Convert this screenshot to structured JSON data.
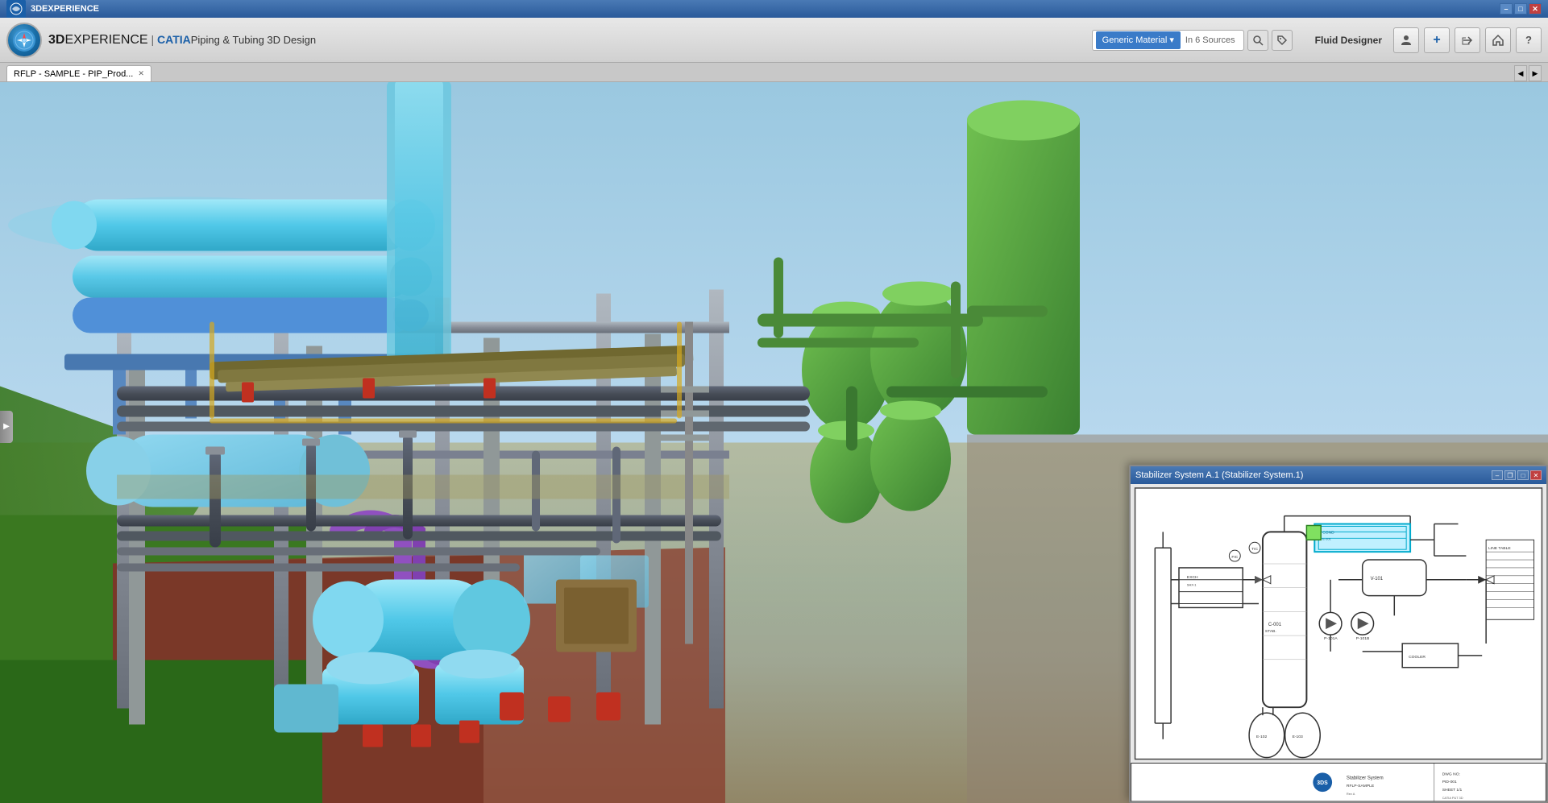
{
  "titlebar": {
    "title": "3DEXPERIENCE",
    "min_label": "–",
    "max_label": "□",
    "close_label": "✕"
  },
  "toolbar": {
    "app_name_prefix": "3D",
    "app_name_suffix": "EXPERIENCE",
    "separator": " | ",
    "catia_label": "CATIA",
    "app_subtitle": "Piping & Tubing 3D Design",
    "fluid_designer_label": "Fluid Designer"
  },
  "search": {
    "material_label": "Generic Material",
    "dropdown_arrow": "▾",
    "sources_text": "In 6 Sources",
    "search_icon": "🔍",
    "tag_icon": "🏷"
  },
  "tab": {
    "label": "RFLP - SAMPLE - PIP_Prod...",
    "close_icon": "✕"
  },
  "tab_nav": {
    "left": "◀",
    "right": "▶"
  },
  "left_toggle": {
    "icon": "▶"
  },
  "pid_panel": {
    "title": "Stabilizer System A.1 (Stabilizer System.1)",
    "min_label": "–",
    "max_label": "□",
    "restore_label": "❐",
    "close_label": "✕"
  },
  "icons": {
    "user": "👤",
    "add": "+",
    "share": "↗",
    "home": "⌂",
    "help": "?"
  }
}
